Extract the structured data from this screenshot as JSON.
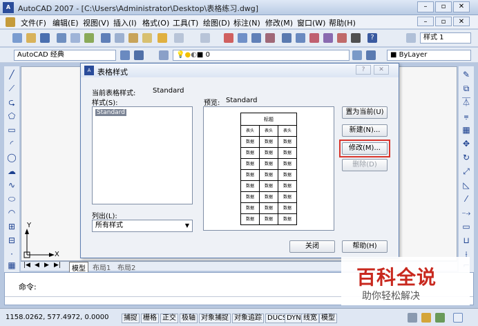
{
  "window": {
    "title": "AutoCAD 2007 - [C:\\Users\\Administrator\\Desktop\\表格练习.dwg]",
    "app_icon_text": "A"
  },
  "menu": [
    "文件(F)",
    "编辑(E)",
    "视图(V)",
    "插入(I)",
    "格式(O)",
    "工具(T)",
    "绘图(D)",
    "标注(N)",
    "修改(M)",
    "窗口(W)",
    "帮助(H)"
  ],
  "toolbar": {
    "text_style_label": "样式 1",
    "workspace": "AutoCAD 经典",
    "layer_value": "0",
    "linetype_value": "ByLayer"
  },
  "tabs": [
    "模型",
    "布局1",
    "布局2"
  ],
  "command": {
    "prompt": "命令:"
  },
  "status": {
    "coordinates": "1158.0262, 577.4972, 0.0000",
    "buttons": [
      "捕捉",
      "栅格",
      "正交",
      "极轴",
      "对象捕捉",
      "对象追踪",
      "DUCS",
      "DYN",
      "线宽",
      "模型"
    ]
  },
  "dialog": {
    "title": "表格样式",
    "current_style_label": "当前表格样式:",
    "current_style_value": "Standard",
    "styles_label": "样式(S):",
    "styles": [
      "Standard"
    ],
    "preview_label": "预览:",
    "preview_value": "Standard",
    "list_label": "列出(L):",
    "list_value": "所有样式",
    "buttons": {
      "set_current": "置为当前(U)",
      "new": "新建(N)...",
      "modify": "修改(M)...",
      "delete": "删除(D)",
      "close": "关闭",
      "help": "帮助(H)"
    },
    "preview_table": {
      "title": "标题",
      "header": [
        "表头",
        "表头",
        "表头"
      ],
      "cell": "数据",
      "data_rows": 8
    }
  },
  "colors": {
    "highlight_box": "#d9342b",
    "selected_item": "#7a8394",
    "watermark_red": "#c8281e"
  },
  "watermark": {
    "line1": "百科全说",
    "line2": "助你轻松解决"
  },
  "axis": {
    "x": "X",
    "y": "Y"
  }
}
